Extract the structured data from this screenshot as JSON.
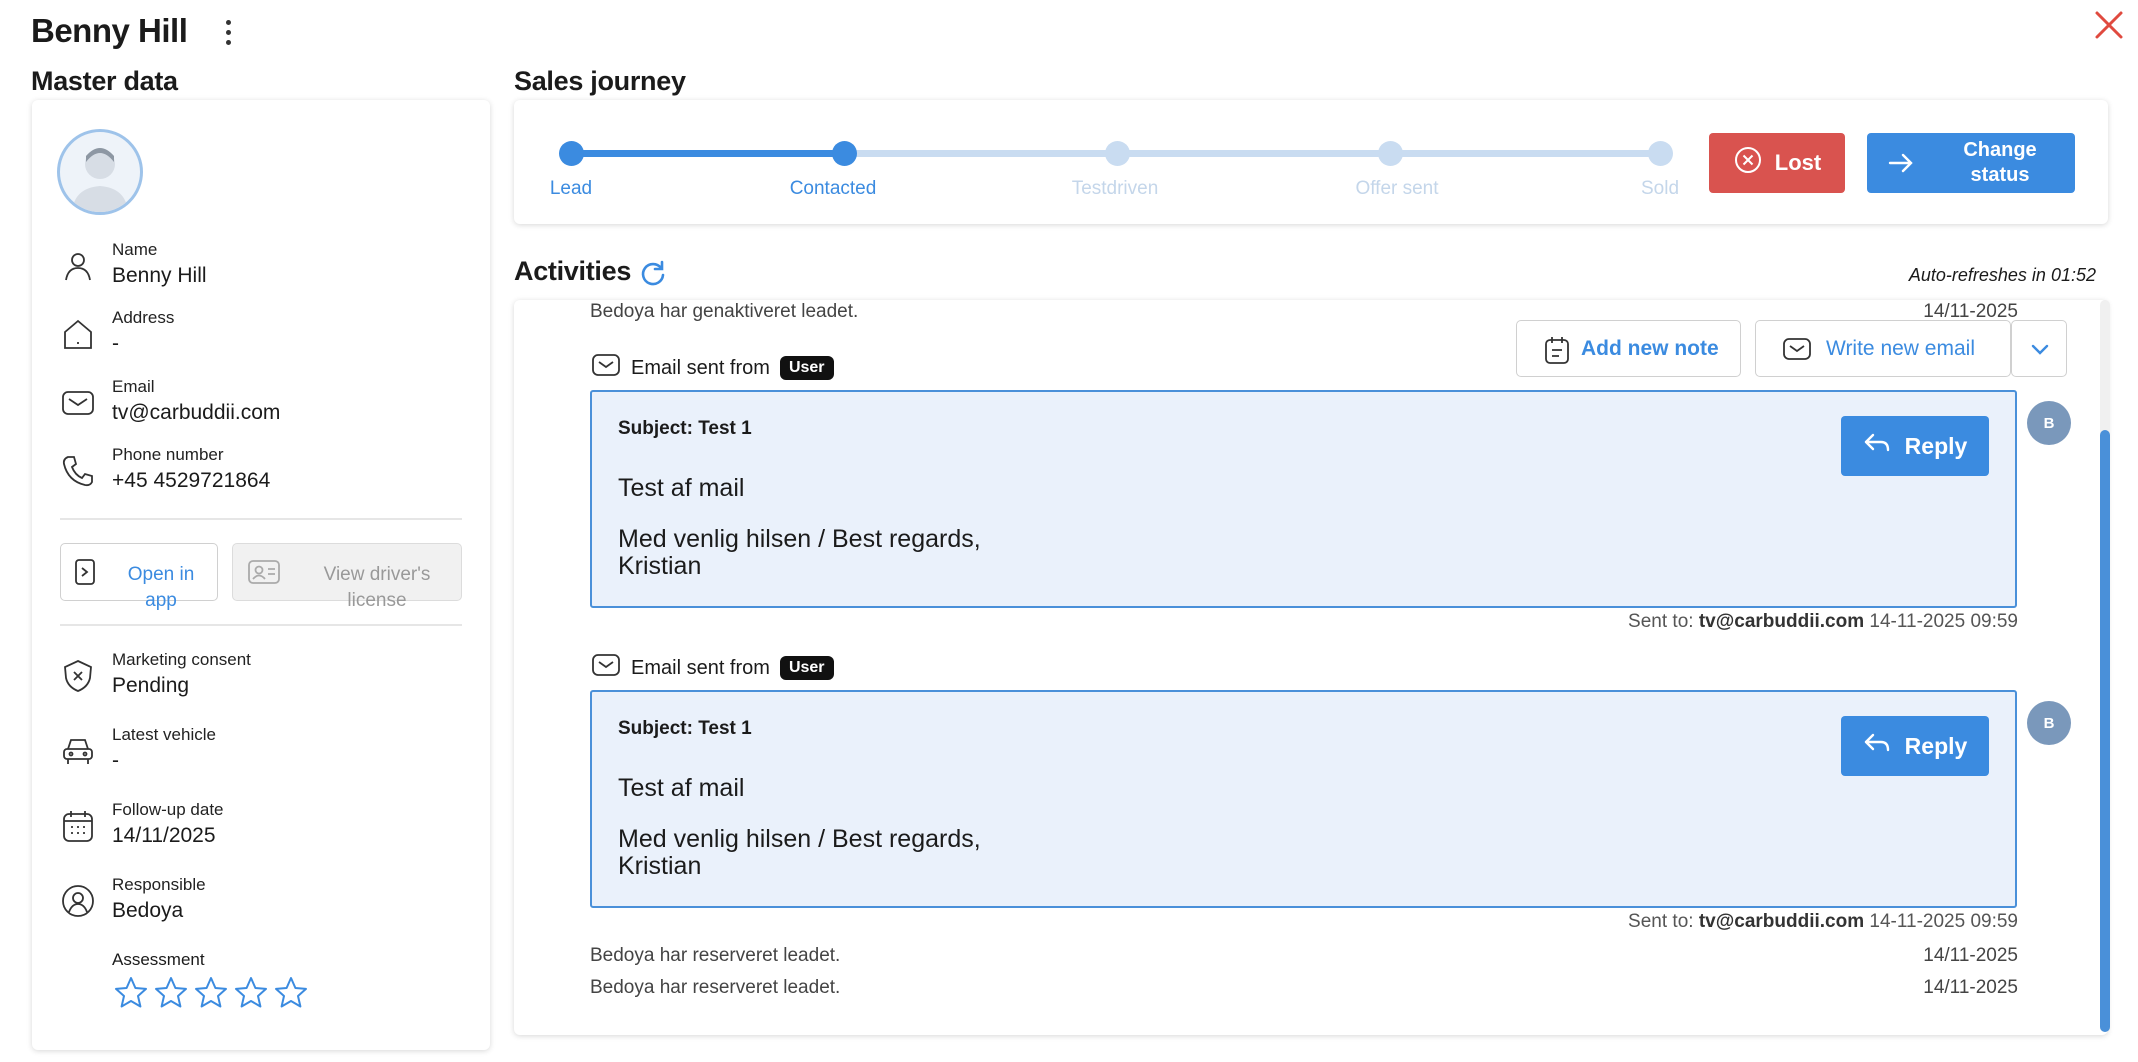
{
  "header": {
    "title": "Benny Hill"
  },
  "master": {
    "section_title": "Master data",
    "fields": [
      {
        "label": "Name",
        "value": "Benny Hill",
        "icon": "person-icon"
      },
      {
        "label": "Address",
        "value": "-",
        "icon": "home-icon"
      },
      {
        "label": "Email",
        "value": "tv@carbuddii.com",
        "icon": "mail-icon"
      },
      {
        "label": "Phone number",
        "value": "+45 4529721864",
        "icon": "phone-icon"
      }
    ],
    "open_in_app": "Open in app",
    "view_license": "View driver's license",
    "fields2": [
      {
        "label": "Marketing consent",
        "value": "Pending",
        "icon": "shield-x-icon"
      },
      {
        "label": "Latest vehicle",
        "value": "-",
        "icon": "car-icon"
      },
      {
        "label": "Follow-up date",
        "value": "14/11/2025",
        "icon": "calendar-icon"
      },
      {
        "label": "Responsible",
        "value": "Bedoya",
        "icon": "user-circle-icon"
      }
    ],
    "assessment": {
      "label": "Assessment",
      "rating": 0,
      "max": 5
    }
  },
  "journey": {
    "section_title": "Sales journey",
    "stages": [
      {
        "label": "Lead",
        "done": true
      },
      {
        "label": "Contacted",
        "done": true
      },
      {
        "label": "Testdriven",
        "done": false
      },
      {
        "label": "Offer sent",
        "done": false
      },
      {
        "label": "Sold",
        "done": false
      }
    ],
    "lost_label": "Lost",
    "change_label_1": "Change",
    "change_label_2": "status"
  },
  "activities": {
    "section_title": "Activities",
    "auto_refresh": "Auto-refreshes in 01:52",
    "add_note": "Add new note",
    "write_email": "Write new email",
    "log_top": {
      "text": "Bedoya har genaktiveret leadet.",
      "date": "14/11-2025"
    },
    "emails": [
      {
        "header": "Email sent from",
        "badge": "User",
        "subject": "Subject: Test 1",
        "body1": "Test af mail",
        "body2a": "Med venlig hilsen / Best regards,",
        "body2b": "Kristian",
        "reply": "Reply",
        "sent_prefix": "Sent to:",
        "sent_to": "tv@carbuddii.com",
        "sent_at": "14-11-2025 09:59",
        "avatar": "B"
      },
      {
        "header": "Email sent from",
        "badge": "User",
        "subject": "Subject: Test 1",
        "body1": "Test af mail",
        "body2a": "Med venlig hilsen / Best regards,",
        "body2b": "Kristian",
        "reply": "Reply",
        "sent_prefix": "Sent to:",
        "sent_to": "tv@carbuddii.com",
        "sent_at": "14-11-2025 09:59",
        "avatar": "B"
      }
    ],
    "logs_bottom": [
      {
        "text": "Bedoya har reserveret leadet.",
        "date": "14/11-2025"
      },
      {
        "text": "Bedoya har reserveret leadet.",
        "date": "14/11-2025"
      }
    ]
  },
  "colors": {
    "primary": "#3b8be0",
    "danger": "#d9534f",
    "close": "#e04a3f",
    "stage_pending": "#c9dcf1"
  }
}
